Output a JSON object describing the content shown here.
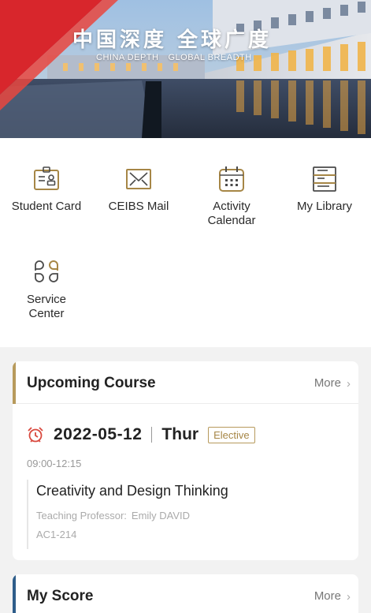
{
  "banner": {
    "title_cn": "中国深度 全球广度",
    "subtitle_left": "CHINA DEPTH",
    "subtitle_right": "GLOBAL BREADTH"
  },
  "quick_access": [
    {
      "label": "Student Card",
      "icon": "id-card-icon"
    },
    {
      "label": "CEIBS Mail",
      "icon": "mail-icon"
    },
    {
      "label": "Activity Calendar",
      "icon": "calendar-icon"
    },
    {
      "label": "My Library",
      "icon": "library-icon"
    },
    {
      "label": "Service Center",
      "icon": "service-center-icon"
    }
  ],
  "upcoming": {
    "title": "Upcoming Course",
    "more": "More",
    "date": "2022-05-12",
    "weekday": "Thur",
    "badge": "Elective",
    "time": "09:00-12:15",
    "course": "Creativity and Design Thinking",
    "professor_label": "Teaching Professor:",
    "professor": "Emily DAVID",
    "room": "AC1-214"
  },
  "score": {
    "title": "My Score",
    "more": "More"
  },
  "colors": {
    "accent_gold": "#b79a5c",
    "accent_blue": "#2e5d8a",
    "brand_red": "#d8262c",
    "alarm_red": "#d94a3f"
  }
}
